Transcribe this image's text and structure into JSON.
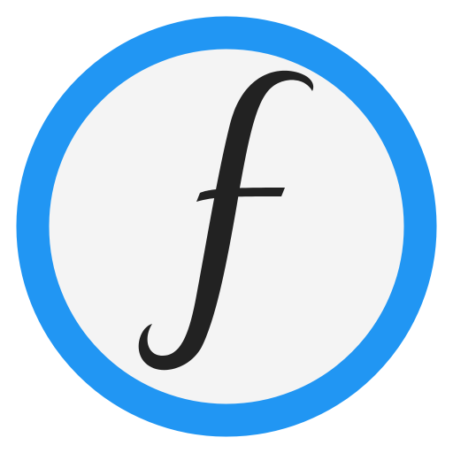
{
  "icon": {
    "name": "function-f-icon",
    "glyph": "f",
    "colors": {
      "ring": "#2196F3",
      "fill": "#F4F4F4",
      "glyph": "#222222",
      "background": "#FFFFFF"
    }
  }
}
